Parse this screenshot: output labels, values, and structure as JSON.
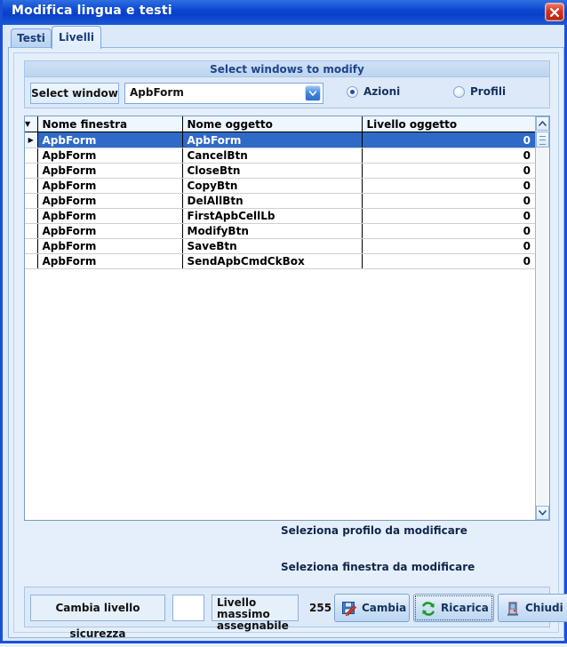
{
  "window": {
    "title": "Modifica lingua e testi",
    "close_icon": "close-icon"
  },
  "tabs": [
    {
      "label": "Testi",
      "active": false
    },
    {
      "label": "Livelli",
      "active": true
    }
  ],
  "select_group": {
    "header": "Select windows to modify",
    "select_window_button": "Select window",
    "combo_value": "ApbForm",
    "combo_arrow_icon": "chevron-down-icon",
    "radios": [
      {
        "label": "Azioni",
        "selected": true
      },
      {
        "label": "Profili",
        "selected": false
      }
    ]
  },
  "grid": {
    "columns": [
      "Nome finestra",
      "Nome oggetto",
      "Livello oggetto"
    ],
    "header_marker": "▼",
    "selected_marker": "▶",
    "rows": [
      {
        "finestra": "ApbForm",
        "oggetto": "ApbForm",
        "livello": "0",
        "selected": true
      },
      {
        "finestra": "ApbForm",
        "oggetto": "CancelBtn",
        "livello": "0",
        "selected": false
      },
      {
        "finestra": "ApbForm",
        "oggetto": "CloseBtn",
        "livello": "0",
        "selected": false
      },
      {
        "finestra": "ApbForm",
        "oggetto": "CopyBtn",
        "livello": "0",
        "selected": false
      },
      {
        "finestra": "ApbForm",
        "oggetto": "DelAllBtn",
        "livello": "0",
        "selected": false
      },
      {
        "finestra": "ApbForm",
        "oggetto": "FirstApbCellLb",
        "livello": "0",
        "selected": false
      },
      {
        "finestra": "ApbForm",
        "oggetto": "ModifyBtn",
        "livello": "0",
        "selected": false
      },
      {
        "finestra": "ApbForm",
        "oggetto": "SaveBtn",
        "livello": "0",
        "selected": false
      },
      {
        "finestra": "ApbForm",
        "oggetto": "SendApbCmdCkBox",
        "livello": "0",
        "selected": false
      }
    ],
    "scrollbar": {
      "up_icon": "scroll-up-arrow-icon",
      "down_icon": "scroll-down-arrow-icon"
    }
  },
  "hints": {
    "profilo": "Seleziona profilo da modificare",
    "finestra": "Seleziona finestra da modificare"
  },
  "bottom": {
    "change_level_label": "Cambia livello sicurezza",
    "level_input_value": "",
    "max_level_label": "Livello massimo assegnabile",
    "max_level_value": "255",
    "buttons": [
      {
        "label": "Cambia",
        "icon": "save-edit-icon",
        "focused": false
      },
      {
        "label": "Ricarica",
        "icon": "refresh-icon",
        "focused": true
      },
      {
        "label": "Chiudi",
        "icon": "exit-door-icon",
        "focused": false
      }
    ]
  },
  "colors": {
    "titlebar": "#0a46d2",
    "accent": "#2f6ac8",
    "panel": "#e4effb",
    "close_red": "#d8331c",
    "refresh_green": "#27a327"
  }
}
